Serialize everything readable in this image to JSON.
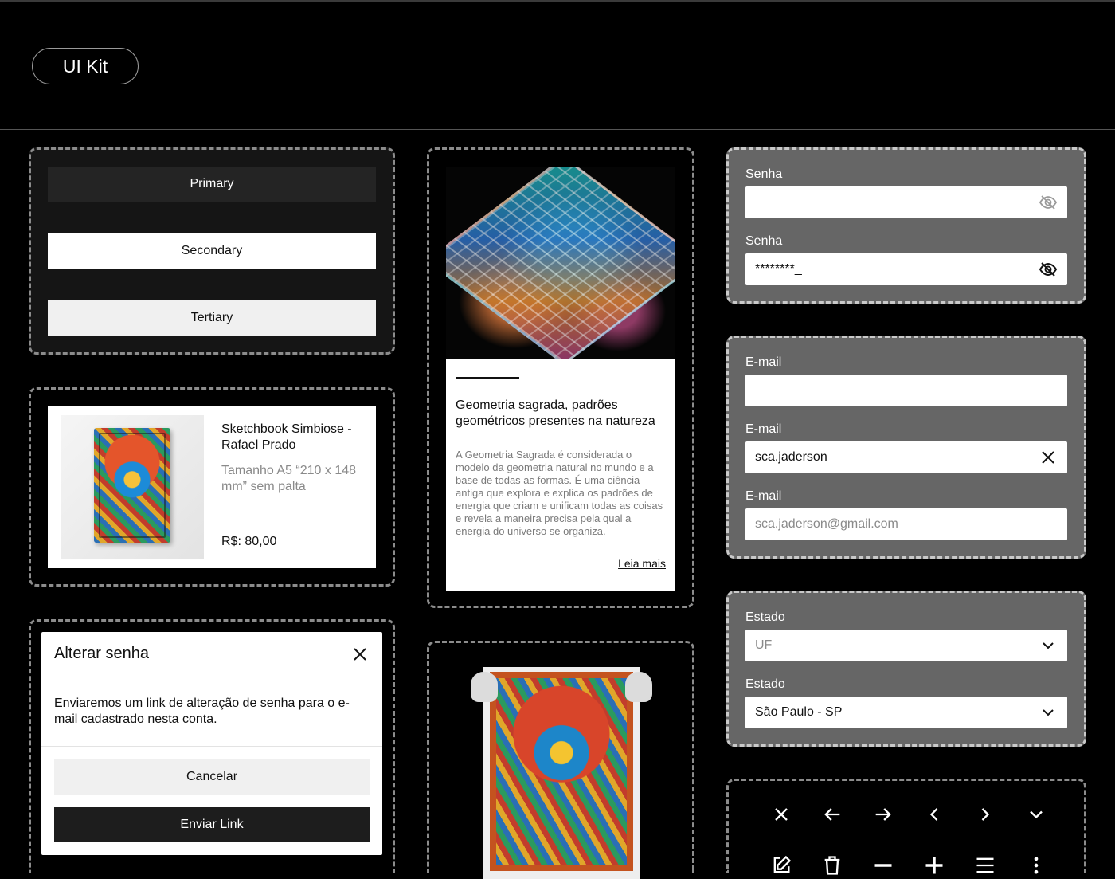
{
  "header": {
    "title": "UI Kit"
  },
  "buttons": {
    "primary": "Primary",
    "secondary": "Secondary",
    "tertiary": "Tertiary"
  },
  "product": {
    "title": "Sketchbook Simbiose - Rafael Prado",
    "size": "Tamanho A5 “210 x 148 mm” sem palta",
    "price": "R$: 80,00"
  },
  "modal": {
    "title": "Alterar senha",
    "body": "Enviaremos um link de alteração de senha para o e-mail cadastrado nesta conta.",
    "cancel": "Cancelar",
    "send": "Enviar Link"
  },
  "article": {
    "title": "Geometria sagrada, padrões geométricos presentes na natureza",
    "text": "A Geometria Sagrada é considerada o modelo da geometria natural no mundo e a base de todas as formas. É uma ciência antiga que explora e explica os padrões de energia que criam e unificam todas as coisas e revela a maneira precisa pela qual a energia do universo se organiza.",
    "link": "Leia mais"
  },
  "password_form": {
    "label1": "Senha",
    "value1": "",
    "label2": "Senha",
    "value2": "********_"
  },
  "email_form": {
    "label1": "E-mail",
    "value1": "",
    "label2": "E-mail",
    "value2": "sca.jaderson",
    "label3": "E-mail",
    "value3": "sca.jaderson@gmail.com"
  },
  "state_form": {
    "label1": "Estado",
    "value1": "UF",
    "label2": "Estado",
    "value2": "São Paulo - SP"
  },
  "icons_row1": [
    "close-icon",
    "arrow-left-icon",
    "arrow-right-icon",
    "chevron-left-icon",
    "chevron-right-icon",
    "chevron-down-icon"
  ],
  "icons_row2": [
    "edit-icon",
    "trash-icon",
    "minus-icon",
    "plus-icon",
    "menu-icon",
    "more-vertical-icon"
  ],
  "colors": {
    "background": "#000000",
    "panel_dark": "#151515",
    "panel_gray": "#666666",
    "primary_button": "#242424"
  }
}
